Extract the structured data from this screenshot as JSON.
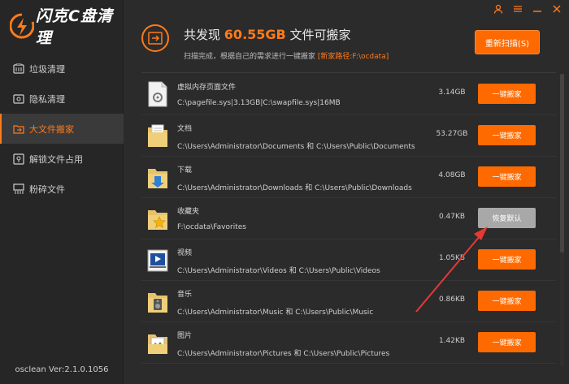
{
  "app": {
    "logo_text": "闪克C盘清理",
    "version": "osclean Ver:2.1.0.1056"
  },
  "nav": [
    {
      "label": "垃圾清理",
      "icon": "trash-icon",
      "active": false
    },
    {
      "label": "隐私清理",
      "icon": "privacy-icon",
      "active": false
    },
    {
      "label": "大文件搬家",
      "icon": "folder-move-icon",
      "active": true
    },
    {
      "label": "解锁文件占用",
      "icon": "unlock-icon",
      "active": false
    },
    {
      "label": "粉碎文件",
      "icon": "shred-icon",
      "active": false
    }
  ],
  "header": {
    "title_prefix": "共发现",
    "amount": "60.55GB",
    "title_suffix": "文件可搬家",
    "sub_text": "扫描完成，根据自己的需求进行一键搬家",
    "sub_path": "[新家路径:F:\\ocdata]",
    "rescan_label": "重新扫描(S)"
  },
  "rows": [
    {
      "name": "虚拟内存页面文件",
      "path": "C:\\pagefile.sys|3.13GB|C:\\swapfile.sys|16MB",
      "size": "3.14GB",
      "action": "一键搬家",
      "icon": "system-file-icon",
      "restore": false
    },
    {
      "name": "文档",
      "path": "C:\\Users\\Administrator\\Documents 和 C:\\Users\\Public\\Documents",
      "size": "53.27GB",
      "action": "一键搬家",
      "icon": "documents-folder-icon",
      "restore": false
    },
    {
      "name": "下载",
      "path": "C:\\Users\\Administrator\\Downloads 和 C:\\Users\\Public\\Downloads",
      "size": "4.08GB",
      "action": "一键搬家",
      "icon": "downloads-folder-icon",
      "restore": false
    },
    {
      "name": "收藏夹",
      "path": "F:\\ocdata\\Favorites",
      "size": "0.47KB",
      "action": "恢复默认",
      "icon": "favorites-folder-icon",
      "restore": true
    },
    {
      "name": "视频",
      "path": "C:\\Users\\Administrator\\Videos 和 C:\\Users\\Public\\Videos",
      "size": "1.05KB",
      "action": "一键搬家",
      "icon": "videos-folder-icon",
      "restore": false
    },
    {
      "name": "音乐",
      "path": "C:\\Users\\Administrator\\Music 和 C:\\Users\\Public\\Music",
      "size": "0.86KB",
      "action": "一键搬家",
      "icon": "music-folder-icon",
      "restore": false
    },
    {
      "name": "图片",
      "path": "C:\\Users\\Administrator\\Pictures 和 C:\\Users\\Public\\Pictures",
      "size": "1.42KB",
      "action": "一键搬家",
      "icon": "pictures-folder-icon",
      "restore": false
    }
  ],
  "colors": {
    "accent": "#ff6a00",
    "restore_button": "#a8a8a8",
    "annotation_arrow": "#e53935"
  }
}
